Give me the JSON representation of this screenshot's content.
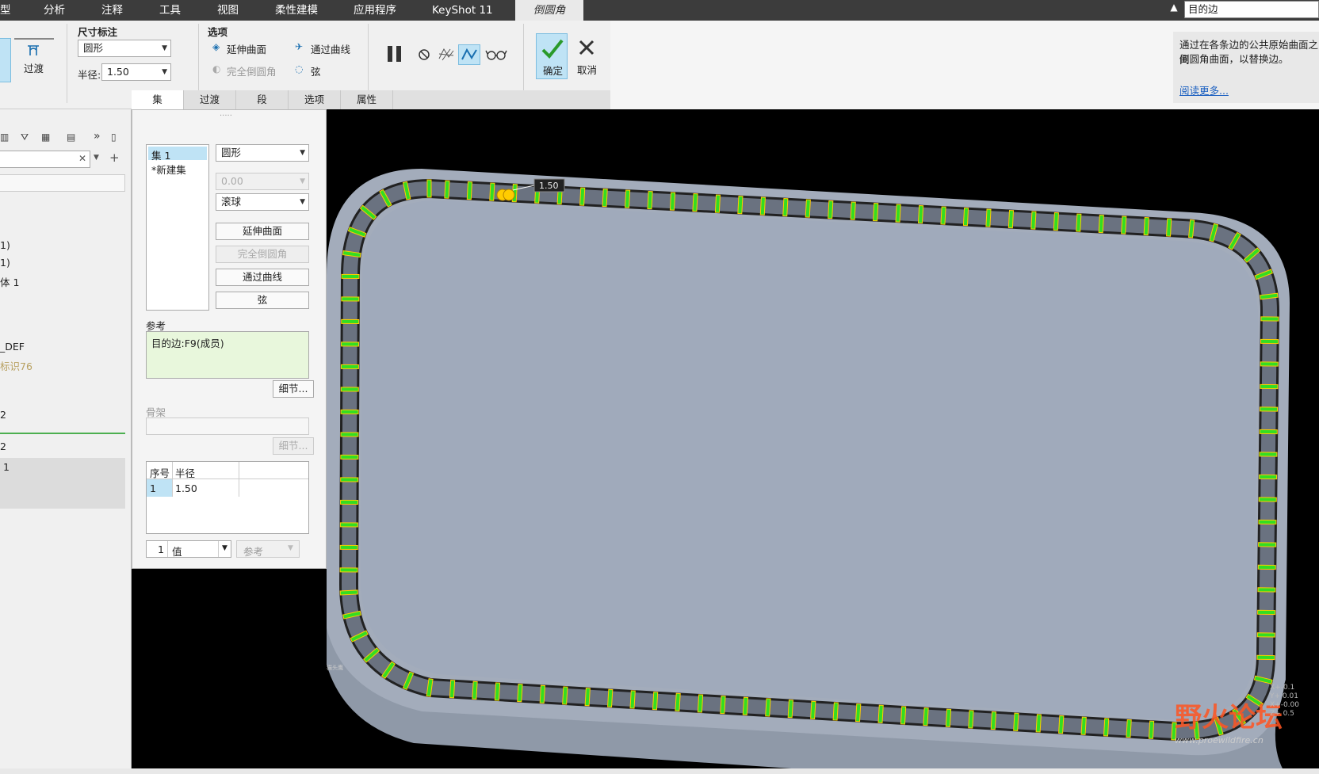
{
  "menubar": {
    "items": [
      "型",
      "分析",
      "注释",
      "工具",
      "视图",
      "柔性建模",
      "应用程序",
      "KeyShot 11"
    ],
    "active_tab": "倒圆角",
    "search_value": "目的边"
  },
  "ribbon": {
    "transition_button": "过渡",
    "dim_group_label": "尺寸标注",
    "shape_value": "圆形",
    "radius_label": "半径:",
    "radius_value": "1.50",
    "options_group_label": "选项",
    "extend_surface": "延伸曲面",
    "through_curve": "通过曲线",
    "full_round": "完全倒圆角",
    "chord": "弦",
    "ok_label": "确定",
    "cancel_label": "取消",
    "tabs": [
      "集",
      "过渡",
      "段",
      "选项",
      "属性"
    ]
  },
  "help": {
    "text_line1": "通过在各条边的公共原始曲面之间",
    "text_line2": "倒圆角曲面，以替换边。",
    "read_more": "阅读更多..."
  },
  "left_panel": {
    "items": [
      "1)",
      "1)",
      "体 1",
      "_DEF",
      "标识76",
      "2",
      "2",
      "1"
    ]
  },
  "set_panel": {
    "sets": [
      "集 1",
      "*新建集"
    ],
    "shape_value": "圆形",
    "distance_value": "0.00",
    "method_value": "滚球",
    "extend_surface": "延伸曲面",
    "full_round": "完全倒圆角",
    "through_curve": "通过曲线",
    "chord": "弦",
    "ref_label": "参考",
    "ref_value": "目的边:F9(成员)",
    "detail_button": "细节...",
    "skeleton_label": "骨架",
    "skeleton_detail": "细节...",
    "table_headers": [
      "序号",
      "半径"
    ],
    "table_rows": [
      [
        "1",
        "1.50"
      ]
    ],
    "row_num": "1",
    "value_combo": "值",
    "ref_combo": "参考"
  },
  "viewport": {
    "dim_label": "1.50",
    "watermark": "www.proewildfire.cn",
    "watermark_brand": "野火论坛",
    "small_label": "猫头鹰",
    "coord_lines": [
      "X+-0.1",
      "Y+ 0.01",
      "X+-0.00",
      "Z+ 0.5"
    ]
  },
  "colors": {
    "menubar_bg": "#3c3c3c",
    "model_face": "#a0aabb",
    "model_side": "#8a95a5",
    "stripe_green": "#33dd22",
    "stripe_yellow": "#ffcc00"
  }
}
